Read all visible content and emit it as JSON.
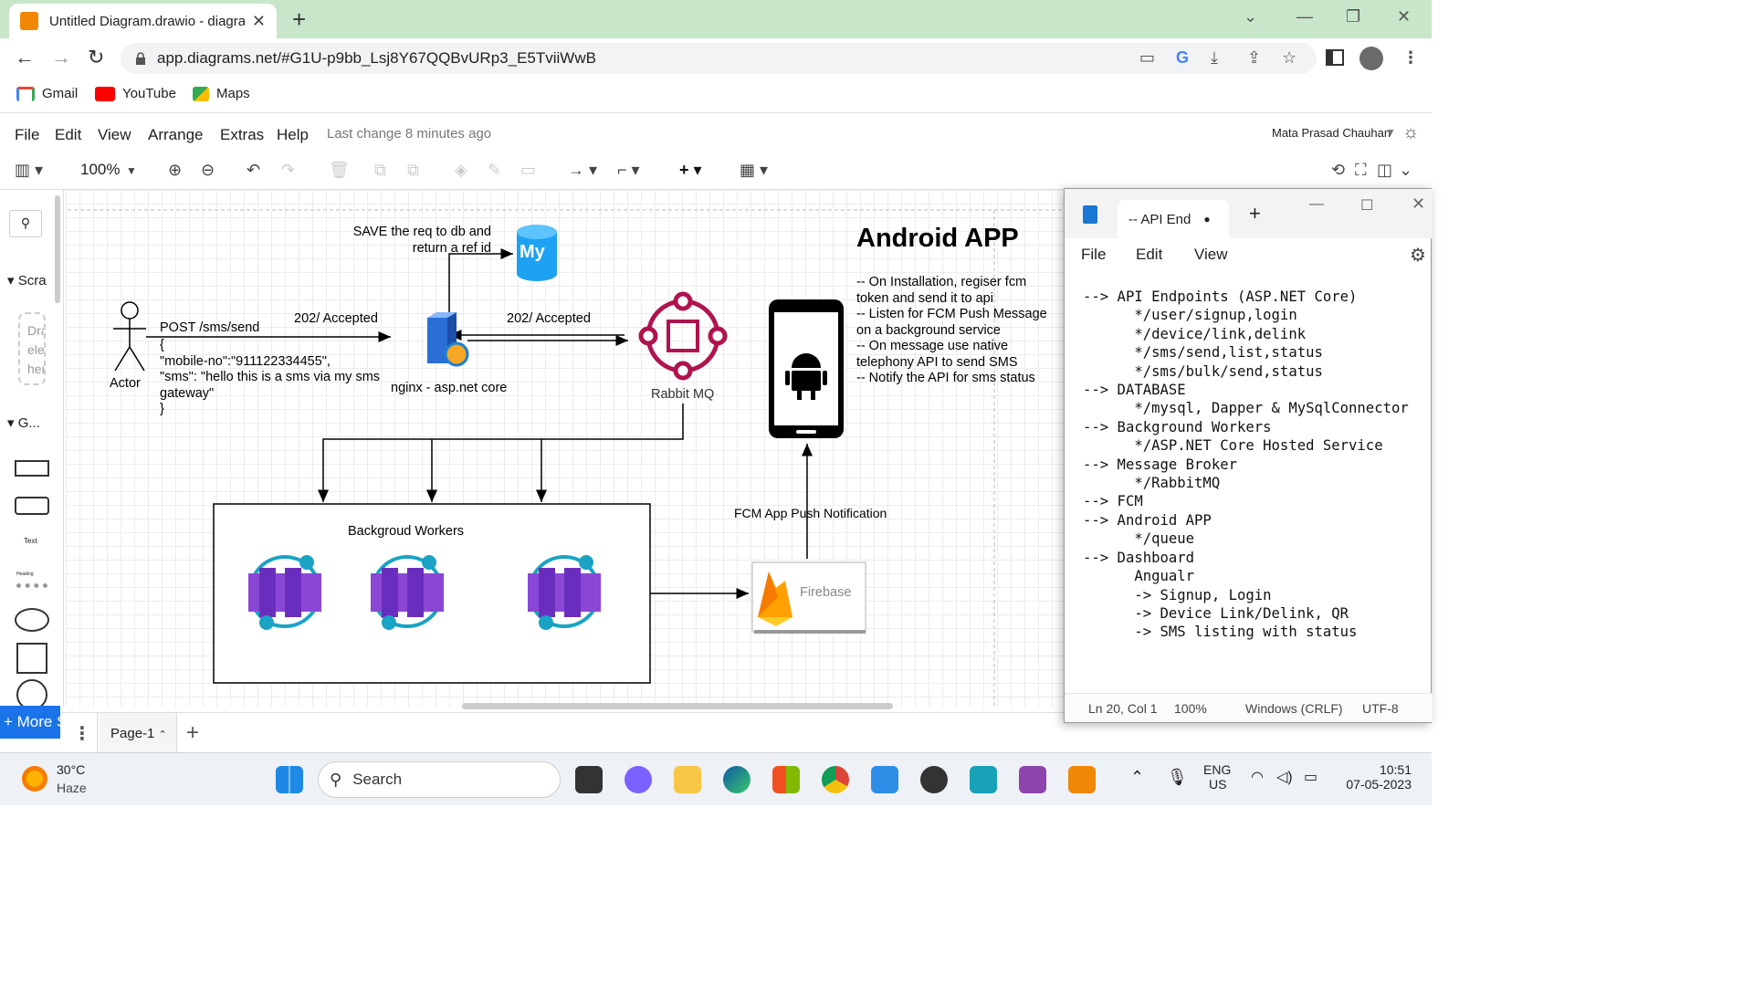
{
  "browser": {
    "tab_title": "Untitled Diagram.drawio - diagra",
    "url": "app.diagrams.net/#G1U-p9bb_Lsj8Y67QQBvURp3_E5TviiWwB",
    "bookmarks": [
      "Gmail",
      "YouTube",
      "Maps"
    ]
  },
  "drawio": {
    "menus": [
      "File",
      "Edit",
      "View",
      "Arrange",
      "Extras",
      "Help"
    ],
    "last_change": "Last change 8 minutes ago",
    "user": "Mata Prasad Chauhan",
    "zoom": "100%",
    "sidebar": {
      "scratchpad": "Scra",
      "drag_hint": [
        "Dra",
        "eler",
        "here"
      ],
      "general": "G...",
      "text_shape": "Text",
      "heading_shape": "Heading"
    },
    "more_shapes": "+ More S",
    "page_tab": "Page-1",
    "diagram": {
      "actor": "Actor",
      "post_label": "POST /sms/send",
      "payload": [
        "{",
        "\"mobile-no\":\"911122334455\",",
        "\"sms\": \"hello this is a sms via my sms",
        "gateway\"",
        "}"
      ],
      "accepted_1": "202/ Accepted",
      "accepted_2": "202/ Accepted",
      "save_note": [
        "SAVE the req to db and",
        "return a ref id"
      ],
      "mysql_label": "My",
      "server": "nginx - asp.net core",
      "rabbit": "Rabbit MQ",
      "android_title": "Android APP",
      "android_notes": [
        "-- On Installation, regiser fcm",
        "token and send it to api",
        "-- Listen for FCM Push Message",
        "on a background service",
        "-- On message use native",
        "telephony API to send SMS",
        "-- Notify the API for sms status"
      ],
      "workers_title": "Backgroud Workers",
      "fcm_label": "FCM App Push Notification",
      "firebase": "Firebase"
    }
  },
  "notepad": {
    "tab_title": "-- API End",
    "menus": [
      "File",
      "Edit",
      "View"
    ],
    "lines": [
      "--> API Endpoints (ASP.NET Core)",
      "      */user/signup,login",
      "      */device/link,delink",
      "      */sms/send,list,status",
      "      */sms/bulk/send,status",
      "--> DATABASE",
      "      */mysql, Dapper & MySqlConnector",
      "--> Background Workers",
      "      */ASP.NET Core Hosted Service",
      "--> Message Broker",
      "      */RabbitMQ",
      "--> FCM",
      "--> Android APP",
      "      */queue",
      "--> Dashboard",
      "      Angualr",
      "      -> Signup, Login",
      "      -> Device Link/Delink, QR",
      "      -> SMS listing with status"
    ],
    "status": {
      "position": "Ln 20, Col 1",
      "zoom": "100%",
      "eol": "Windows (CRLF)",
      "encoding": "UTF-8"
    }
  },
  "taskbar": {
    "temp": "30°C",
    "weather": "Haze",
    "search": "Search",
    "lang1": "ENG",
    "lang2": "US",
    "time": "10:51",
    "date": "07-05-2023"
  }
}
